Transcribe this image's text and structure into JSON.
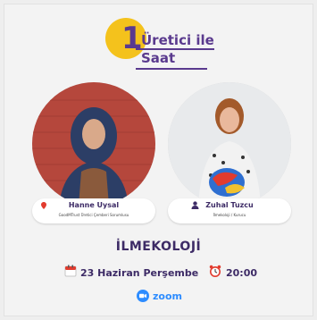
{
  "header": {
    "number": "1",
    "title_line1": "Üretici ile",
    "title_line2": "Saat"
  },
  "speakers": [
    {
      "name": "Hanne Uysal",
      "role": "GoodMTrust Üretici Çemberi Sorumlusu"
    },
    {
      "name": "Zuhal Tuzcu",
      "role": "İlmekoloji / Kurucu"
    }
  ],
  "event": {
    "title": "İLMEKOLOJİ",
    "date": "23 Haziran Perşembe",
    "time": "20:00",
    "platform": "zoom"
  },
  "icons": {
    "calendar": "calendar-icon",
    "clock": "alarm-clock-icon",
    "zoom": "zoom-icon",
    "user": "user-icon"
  },
  "colors": {
    "accent_yellow": "#f4c21c",
    "brand_purple": "#5a3a8e",
    "zoom_blue": "#2d8cff"
  }
}
